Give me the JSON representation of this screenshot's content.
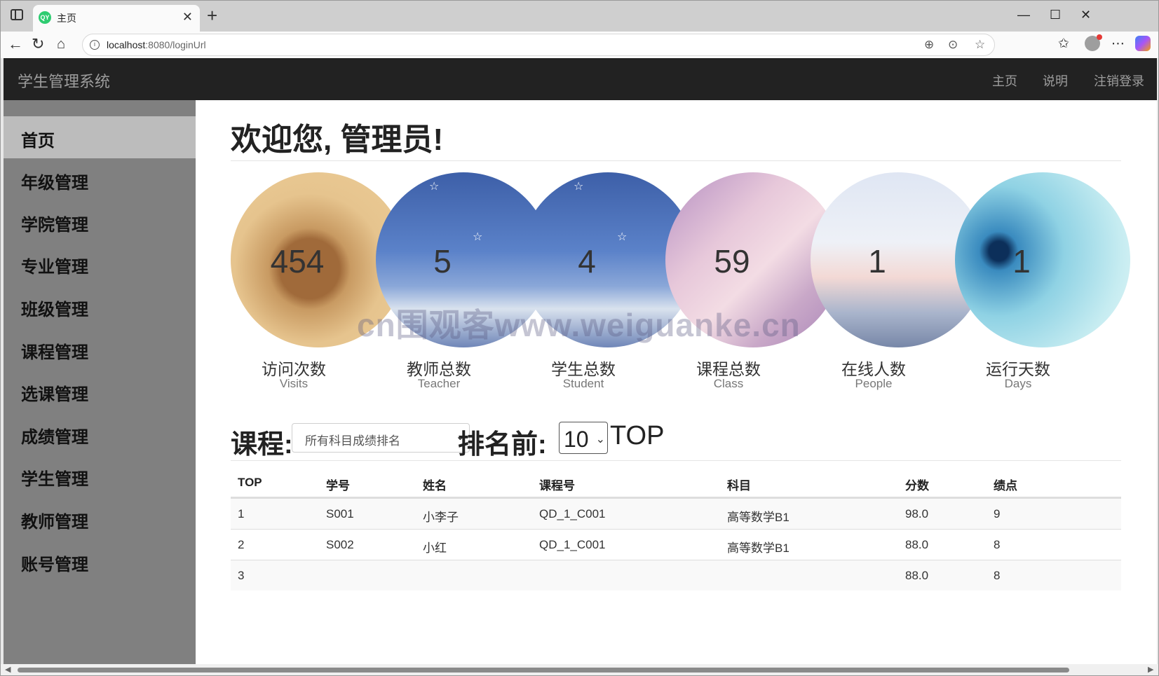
{
  "browser": {
    "tab_title": "主页",
    "favicon_text": "QY",
    "url_host": "localhost",
    "url_port": ":8080",
    "url_path": "/loginUrl"
  },
  "navbar": {
    "brand": "学生管理系统",
    "links": [
      "主页",
      "说明",
      "注销登录"
    ]
  },
  "sidebar": {
    "items": [
      {
        "label": "首页",
        "active": true
      },
      {
        "label": "年级管理"
      },
      {
        "label": "学院管理"
      },
      {
        "label": "专业管理"
      },
      {
        "label": "班级管理"
      },
      {
        "label": "课程管理"
      },
      {
        "label": "选课管理"
      },
      {
        "label": "成绩管理"
      },
      {
        "label": "学生管理"
      },
      {
        "label": "教师管理"
      },
      {
        "label": "账号管理"
      }
    ]
  },
  "main": {
    "greeting": "欢迎您, 管理员!",
    "stats": [
      {
        "value": "454",
        "label": "访问次数",
        "sub": "Visits"
      },
      {
        "value": "5",
        "label": "教师总数",
        "sub": "Teacher"
      },
      {
        "value": "4",
        "label": "学生总数",
        "sub": "Student"
      },
      {
        "value": "59",
        "label": "课程总数",
        "sub": "Class"
      },
      {
        "value": "1",
        "label": "在线人数",
        "sub": "People"
      },
      {
        "value": "1",
        "label": "运行天数",
        "sub": "Days"
      }
    ],
    "watermark": "cn围观客www.weiguanke.cn",
    "filter": {
      "course_label": "课程:",
      "course_selected": "所有科目成绩排名",
      "rank_label": "排名前:",
      "top_selected": "10",
      "top_suffix": "TOP"
    },
    "table": {
      "headers": [
        "TOP",
        "学号",
        "姓名",
        "课程号",
        "科目",
        "分数",
        "绩点"
      ],
      "rows": [
        [
          "1",
          "S001",
          "小李子",
          "QD_1_C001",
          "高等数学B1",
          "98.0",
          "9"
        ],
        [
          "2",
          "S002",
          "小红",
          "QD_1_C001",
          "高等数学B1",
          "88.0",
          "8"
        ],
        [
          "3",
          "",
          "",
          "",
          "",
          "88.0",
          "8"
        ]
      ]
    }
  }
}
